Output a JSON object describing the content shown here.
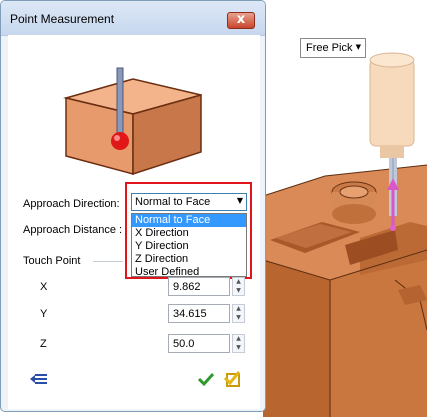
{
  "dialog": {
    "title": "Point Measurement",
    "close_glyph": "x"
  },
  "approach_direction": {
    "label": "Approach Direction:",
    "selected": "Normal to Face",
    "options": [
      "Normal to Face",
      "X Direction",
      "Y Direction",
      "Z Direction",
      "User Defined"
    ]
  },
  "approach_distance": {
    "label": "Approach Distance :"
  },
  "touch_point": {
    "label": "Touch Point",
    "x": {
      "label": "X",
      "value": "9.862"
    },
    "y": {
      "label": "Y",
      "value": "34.615"
    },
    "z": {
      "label": "Z",
      "value": "50.0"
    }
  },
  "viewport": {
    "free_pick_label": "Free Pick"
  },
  "colors": {
    "highlight": "#e0141a",
    "selection": "#3399ff",
    "block": "#e8a57f",
    "probe_tip": "#e01818"
  },
  "icons": [
    "close-icon",
    "chevron-down-icon",
    "spin-up-icon",
    "spin-down-icon",
    "list-icon",
    "check-icon",
    "apply-icon"
  ]
}
